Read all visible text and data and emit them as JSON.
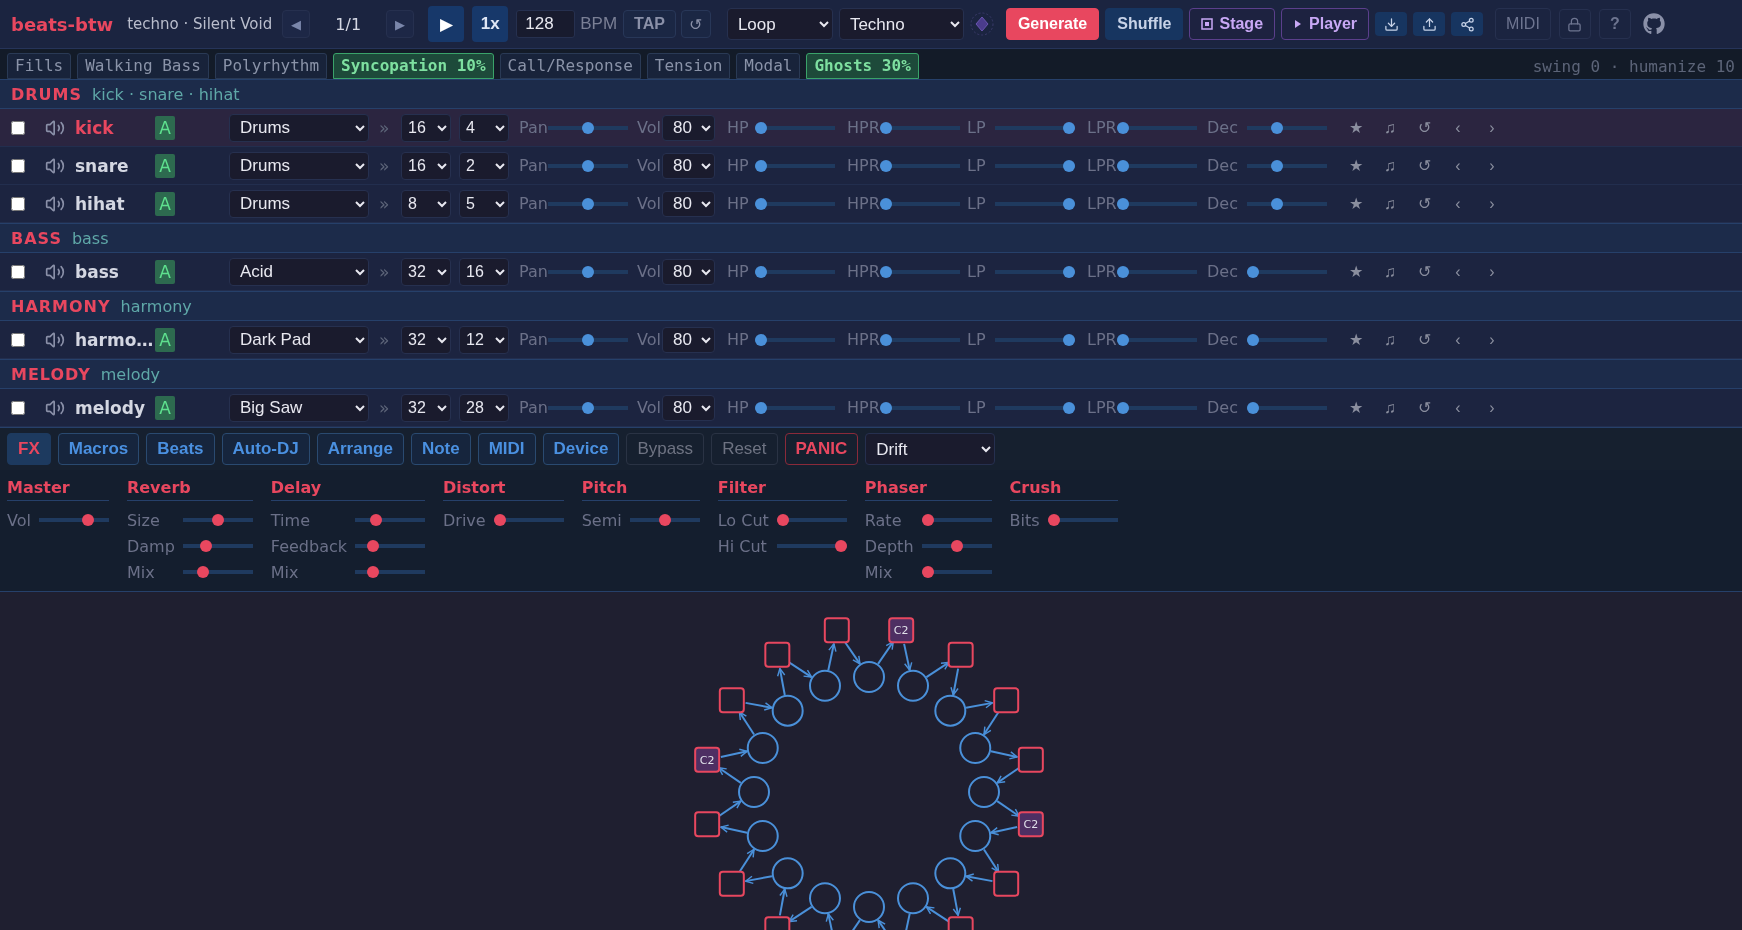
{
  "app": {
    "logo": "beats-btw",
    "subtitle": "techno · Silent Void"
  },
  "transport": {
    "prev": {
      "label": "◀",
      "disabled": true
    },
    "position": "1/1",
    "next": {
      "label": "▶",
      "disabled": true
    },
    "play": "▶",
    "speed": "1x",
    "bpm": "128",
    "bpm_unit": "BPM",
    "tap": "TAP",
    "reset": "↺"
  },
  "mode_select": "Loop",
  "style_select": "Techno",
  "actions": [
    {
      "label": "Generate",
      "kind": "primary"
    },
    {
      "label": "Shuffle",
      "kind": "secondary"
    },
    {
      "label": "Stage",
      "kind": "stage"
    },
    {
      "label": "Player",
      "kind": "player"
    }
  ],
  "midi": "MIDI",
  "help": "?",
  "tags": [
    {
      "label": "Fills",
      "on": false
    },
    {
      "label": "Walking Bass",
      "on": false
    },
    {
      "label": "Polyrhythm",
      "on": false
    },
    {
      "label": "Syncopation 10%",
      "on": true
    },
    {
      "label": "Call/Response",
      "on": false
    },
    {
      "label": "Tension",
      "on": false
    },
    {
      "label": "Modal",
      "on": false
    },
    {
      "label": "Ghosts 30%",
      "on": true
    }
  ],
  "tag_status": "swing 0 · humanize 10",
  "groups": [
    {
      "name": "DRUMS",
      "members": "kick · snare · hihat",
      "tracks": [
        {
          "name": "kick",
          "active": true,
          "checked": false,
          "badge": "A",
          "instrument": "Drums",
          "arrow": "»",
          "steps": "16",
          "pulses": "4",
          "controls": [
            {
              "label": "Pan",
              "kind": "slider",
              "level": 0.5
            },
            {
              "label": "Vol",
              "kind": "select",
              "value": "80"
            },
            {
              "label": "HP",
              "kind": "slider",
              "level": 0
            },
            {
              "label": "HPR",
              "kind": "slider",
              "level": 0
            },
            {
              "label": "LP",
              "kind": "slider",
              "level": 1
            },
            {
              "label": "LPR",
              "kind": "slider",
              "level": 0
            },
            {
              "label": "Dec",
              "kind": "slider",
              "level": 0.35
            }
          ],
          "buttons": [
            "★",
            "♫",
            "↺",
            "‹",
            "›"
          ]
        },
        {
          "name": "snare",
          "active": false,
          "checked": false,
          "badge": "A",
          "instrument": "Drums",
          "arrow": "»",
          "steps": "16",
          "pulses": "2",
          "controls": [
            {
              "label": "Pan",
              "kind": "slider",
              "level": 0.5
            },
            {
              "label": "Vol",
              "kind": "select",
              "value": "80"
            },
            {
              "label": "HP",
              "kind": "slider",
              "level": 0
            },
            {
              "label": "HPR",
              "kind": "slider",
              "level": 0
            },
            {
              "label": "LP",
              "kind": "slider",
              "level": 1
            },
            {
              "label": "LPR",
              "kind": "slider",
              "level": 0
            },
            {
              "label": "Dec",
              "kind": "slider",
              "level": 0.35
            }
          ],
          "buttons": [
            "★",
            "♫",
            "↺",
            "‹",
            "›"
          ]
        },
        {
          "name": "hihat",
          "active": false,
          "checked": false,
          "badge": "A",
          "instrument": "Drums",
          "arrow": "»",
          "steps": "8",
          "pulses": "5",
          "controls": [
            {
              "label": "Pan",
              "kind": "slider",
              "level": 0.5
            },
            {
              "label": "Vol",
              "kind": "select",
              "value": "80"
            },
            {
              "label": "HP",
              "kind": "slider",
              "level": 0
            },
            {
              "label": "HPR",
              "kind": "slider",
              "level": 0
            },
            {
              "label": "LP",
              "kind": "slider",
              "level": 1
            },
            {
              "label": "LPR",
              "kind": "slider",
              "level": 0
            },
            {
              "label": "Dec",
              "kind": "slider",
              "level": 0.35
            }
          ],
          "buttons": [
            "★",
            "♫",
            "↺",
            "‹",
            "›"
          ]
        }
      ]
    },
    {
      "name": "BASS",
      "members": "bass",
      "tracks": [
        {
          "name": "bass",
          "active": false,
          "checked": false,
          "badge": "A",
          "instrument": "Acid",
          "arrow": "»",
          "steps": "32",
          "pulses": "16",
          "controls": [
            {
              "label": "Pan",
              "kind": "slider",
              "level": 0.5
            },
            {
              "label": "Vol",
              "kind": "select",
              "value": "80"
            },
            {
              "label": "HP",
              "kind": "slider",
              "level": 0
            },
            {
              "label": "HPR",
              "kind": "slider",
              "level": 0
            },
            {
              "label": "LP",
              "kind": "slider",
              "level": 1
            },
            {
              "label": "LPR",
              "kind": "slider",
              "level": 0
            },
            {
              "label": "Dec",
              "kind": "slider",
              "level": 0
            }
          ],
          "buttons": [
            "★",
            "♫",
            "↺",
            "‹",
            "›"
          ]
        }
      ]
    },
    {
      "name": "HARMONY",
      "members": "harmony",
      "tracks": [
        {
          "name": "harmo…",
          "active": false,
          "checked": false,
          "badge": "A",
          "instrument": "Dark Pad",
          "arrow": "»",
          "steps": "32",
          "pulses": "12",
          "controls": [
            {
              "label": "Pan",
              "kind": "slider",
              "level": 0.5
            },
            {
              "label": "Vol",
              "kind": "select",
              "value": "80"
            },
            {
              "label": "HP",
              "kind": "slider",
              "level": 0
            },
            {
              "label": "HPR",
              "kind": "slider",
              "level": 0
            },
            {
              "label": "LP",
              "kind": "slider",
              "level": 1
            },
            {
              "label": "LPR",
              "kind": "slider",
              "level": 0
            },
            {
              "label": "Dec",
              "kind": "slider",
              "level": 0
            }
          ],
          "buttons": [
            "★",
            "♫",
            "↺",
            "‹",
            "›"
          ]
        }
      ]
    },
    {
      "name": "MELODY",
      "members": "melody",
      "tracks": [
        {
          "name": "melody",
          "active": false,
          "checked": false,
          "badge": "A",
          "instrument": "Big Saw",
          "arrow": "»",
          "steps": "32",
          "pulses": "28",
          "controls": [
            {
              "label": "Pan",
              "kind": "slider",
              "level": 0.5
            },
            {
              "label": "Vol",
              "kind": "select",
              "value": "80"
            },
            {
              "label": "HP",
              "kind": "slider",
              "level": 0
            },
            {
              "label": "HPR",
              "kind": "slider",
              "level": 0
            },
            {
              "label": "LP",
              "kind": "slider",
              "level": 1
            },
            {
              "label": "LPR",
              "kind": "slider",
              "level": 0
            },
            {
              "label": "Dec",
              "kind": "slider",
              "level": 0
            }
          ],
          "buttons": [
            "★",
            "♫",
            "↺",
            "‹",
            "›"
          ]
        }
      ]
    }
  ],
  "fx_tabs": [
    {
      "label": "FX",
      "kind": "tab",
      "selected": true
    },
    {
      "label": "Macros",
      "kind": "tab",
      "selected": false
    },
    {
      "label": "Beats",
      "kind": "tab",
      "selected": false
    },
    {
      "label": "Auto-DJ",
      "kind": "tab",
      "selected": false
    },
    {
      "label": "Arrange",
      "kind": "tab",
      "selected": false
    },
    {
      "label": "Note",
      "kind": "tab",
      "selected": false
    },
    {
      "label": "MIDI",
      "kind": "tab",
      "selected": false
    },
    {
      "label": "Device",
      "kind": "tab",
      "selected": false
    },
    {
      "label": "Bypass",
      "kind": "muted"
    },
    {
      "label": "Reset",
      "kind": "muted"
    },
    {
      "label": "PANIC",
      "kind": "danger"
    }
  ],
  "fx_preset": "Drift",
  "fx_sections": [
    {
      "title": "Master",
      "params": [
        {
          "label": "Vol",
          "level": 0.75
        }
      ]
    },
    {
      "title": "Reverb",
      "params": [
        {
          "label": "Size",
          "level": 0.5
        },
        {
          "label": "Damp",
          "level": 0.3
        },
        {
          "label": "Mix",
          "level": 0.25
        }
      ]
    },
    {
      "title": "Delay",
      "params": [
        {
          "label": "Time",
          "level": 0.25
        },
        {
          "label": "Feedback",
          "level": 0.2
        },
        {
          "label": "Mix",
          "level": 0.2
        }
      ]
    },
    {
      "title": "Distort",
      "params": [
        {
          "label": "Drive",
          "level": 0
        }
      ]
    },
    {
      "title": "Pitch",
      "params": [
        {
          "label": "Semi",
          "level": 0.5
        }
      ]
    },
    {
      "title": "Filter",
      "params": [
        {
          "label": "Lo Cut",
          "level": 0
        },
        {
          "label": "Hi Cut",
          "level": 1
        }
      ]
    },
    {
      "title": "Phaser",
      "params": [
        {
          "label": "Rate",
          "level": 0
        },
        {
          "label": "Depth",
          "level": 0.5
        },
        {
          "label": "Mix",
          "level": 0
        }
      ]
    },
    {
      "title": "Crush",
      "params": [
        {
          "label": "Bits",
          "level": 0
        }
      ]
    }
  ],
  "ring": {
    "slots": [
      {
        "filled": true,
        "note": "C2"
      },
      {
        "filled": false
      },
      {
        "filled": false
      },
      {
        "filled": false
      },
      {
        "filled": true,
        "note": "C2"
      },
      {
        "filled": false
      },
      {
        "filled": false
      },
      {
        "filled": false
      },
      {
        "filled": false
      },
      {
        "filled": false
      },
      {
        "filled": true,
        "note": "C2"
      },
      {
        "filled": false
      },
      {
        "filled": false
      },
      {
        "filled": false
      }
    ]
  }
}
